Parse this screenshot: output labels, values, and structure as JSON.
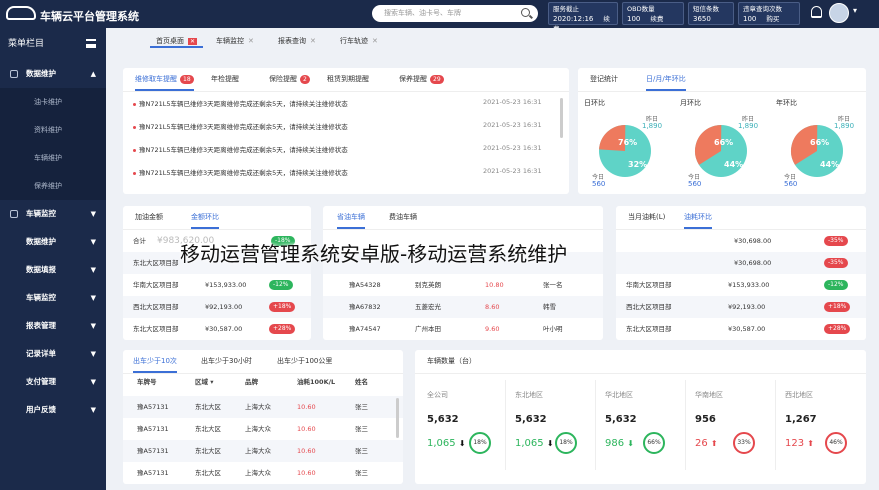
{
  "app": {
    "title": "车辆云平台管理系统"
  },
  "search": {
    "placeholder": "搜索车辆、油卡号、车牌"
  },
  "topstats": [
    {
      "label": "服务截止",
      "value": "2020:12:16",
      "action": "续费"
    },
    {
      "label": "OBD数量",
      "value": "100",
      "action": "续费"
    },
    {
      "label": "短信条数",
      "value": "3650",
      "action": ""
    },
    {
      "label": "违章查询次数",
      "value": "100",
      "action": "购买"
    }
  ],
  "sidebar": {
    "header": "菜单栏目",
    "items": [
      {
        "label": "数据维护",
        "expanded": true,
        "subs": [
          "油卡维护",
          "资料维护",
          "车辆维护",
          "保养维护"
        ]
      },
      {
        "label": "车辆监控"
      },
      {
        "label": "数据维护"
      },
      {
        "label": "数据填报"
      },
      {
        "label": "车辆监控"
      },
      {
        "label": "报表管理"
      },
      {
        "label": "记录详单"
      },
      {
        "label": "支付管理"
      },
      {
        "label": "用户反馈"
      }
    ]
  },
  "tabs": [
    {
      "label": "首页桌面",
      "close": "✕"
    },
    {
      "label": "车辆监控",
      "close": "✕"
    },
    {
      "label": "报表查询",
      "close": "✕"
    },
    {
      "label": "行车轨迹",
      "close": "✕"
    }
  ],
  "reminders": {
    "tabs": [
      {
        "label": "维修取车提醒",
        "badge": "18"
      },
      {
        "label": "年检提醒",
        "badge": ""
      },
      {
        "label": "保险提醒",
        "badge": "2"
      },
      {
        "label": "租赁到期提醒",
        "badge": ""
      },
      {
        "label": "保养提醒",
        "badge": "29"
      }
    ],
    "items": [
      {
        "text": "豫N721L5车辆已维修3天距离维修完成还剩余5天，请持续关注维修状态",
        "time": "2021-05-23 16:31"
      },
      {
        "text": "豫N721L5车辆已维修3天距离维修完成还剩余5天，请持续关注维修状态",
        "time": "2021-05-23 16:31"
      },
      {
        "text": "豫N721L5车辆已维修3天距离维修完成还剩余5天，请持续关注维修状态",
        "time": "2021-05-23 16:31"
      },
      {
        "text": "豫N721L5车辆已维修3天距离维修完成还剩余5天，请持续关注维修状态",
        "time": "2021-05-23 16:31"
      }
    ]
  },
  "stats": {
    "tabs": [
      "登记统计",
      "日/月/年环比"
    ],
    "gauges": [
      {
        "title": "日环比",
        "prev_label": "昨日",
        "prev": "1,890",
        "today_label": "今日",
        "today": "560",
        "pct1": "76%",
        "pct2": "32%",
        "fraction": 0.76
      },
      {
        "title": "月环比",
        "prev_label": "昨日",
        "prev": "1,890",
        "today_label": "今日",
        "today": "560",
        "pct1": "66%",
        "pct2": "44%",
        "fraction": 0.66
      },
      {
        "title": "年环比",
        "prev_label": "昨日",
        "prev": "1,890",
        "today_label": "今日",
        "today": "560",
        "pct1": "66%",
        "pct2": "44%",
        "fraction": 0.66
      }
    ]
  },
  "fuel_amount": {
    "tabs": [
      "加油金额",
      "金额环比"
    ],
    "rows": [
      {
        "name": "合计",
        "value": "¥983,620.00",
        "pill": "-18%"
      },
      {
        "name": "东北大区项目部",
        "value": "",
        "pill": ""
      },
      {
        "name": "华南大区项目部",
        "value": "¥153,933.00",
        "pill": "-12%",
        "green": true
      },
      {
        "name": "西北大区项目部",
        "value": "¥92,193.00",
        "pill": "+18%"
      },
      {
        "name": "东北大区项目部",
        "value": "¥30,587.00",
        "pill": "+28%"
      }
    ]
  },
  "fuel_vehicle": {
    "tabs": [
      "省油车辆",
      "费油车辆"
    ],
    "rows": [
      {
        "plate": "",
        "model": "",
        "value": "",
        "driver": ""
      },
      {
        "plate": "",
        "model": "",
        "value": "",
        "driver": ""
      },
      {
        "plate": "豫A54328",
        "model": "别克英朗",
        "value": "10.80",
        "driver": "张一名"
      },
      {
        "plate": "豫A67832",
        "model": "五菱宏光",
        "value": "8.60",
        "driver": "韩雪"
      },
      {
        "plate": "豫A74547",
        "model": "广州本田",
        "value": "9.60",
        "driver": "叶小明"
      }
    ]
  },
  "monthly_fuel": {
    "tabs": [
      "当月油耗(L)",
      "油耗环比"
    ],
    "rows": [
      {
        "name": "",
        "value": "¥30,698.00",
        "pill": "-35%"
      },
      {
        "name": "",
        "value": "¥30,698.00",
        "pill": "-35%"
      },
      {
        "name": "华南大区项目部",
        "value": "¥153,933.00",
        "pill": "-12%",
        "green": true
      },
      {
        "name": "西北大区项目部",
        "value": "¥92,193.00",
        "pill": "+18%"
      },
      {
        "name": "东北大区项目部",
        "value": "¥30,587.00",
        "pill": "+28%"
      }
    ]
  },
  "dispatch": {
    "tabs": [
      "出车少于10次",
      "出车少于30小时",
      "出车少于100公里"
    ],
    "headers": [
      "车牌号",
      "区域 ▾",
      "品牌",
      "油耗100K/L",
      "姓名"
    ],
    "rows": [
      [
        "豫A57131",
        "东北大区",
        "上海大众",
        "10.60",
        "张三"
      ],
      [
        "豫A57131",
        "东北大区",
        "上海大众",
        "10.60",
        "张三"
      ],
      [
        "豫A57131",
        "东北大区",
        "上海大众",
        "10.60",
        "张三"
      ],
      [
        "豫A57131",
        "东北大区",
        "上海大众",
        "10.60",
        "张三"
      ]
    ]
  },
  "vehicle_count": {
    "title": "车辆数量（台）",
    "cols": [
      {
        "region": "全公司",
        "total": "5,632",
        "sub": "1,065",
        "arrow": "⬇",
        "pct": "18%",
        "red": false
      },
      {
        "region": "东北地区",
        "total": "5,632",
        "sub": "1,065",
        "arrow": "⬇",
        "pct": "18%",
        "red": false
      },
      {
        "region": "华北地区",
        "total": "5,632",
        "sub": "986",
        "arrow": "⬇",
        "pct": "66%",
        "red": false
      },
      {
        "region": "华南地区",
        "total": "956",
        "sub": "26",
        "arrow": "⬆",
        "pct": "33%",
        "red": true
      },
      {
        "region": "西北地区",
        "total": "1,267",
        "sub": "123",
        "arrow": "⬆",
        "pct": "46%",
        "red": true
      }
    ]
  },
  "watermark": "移动运营管理系统安卓版-移动运营系统维护",
  "colors": {
    "navy": "#1b2a4a",
    "accent": "#3b6fd6",
    "teal": "#5fd3c7",
    "salmon": "#ee7a5e",
    "red": "#e5484d",
    "green": "#2db55d"
  }
}
